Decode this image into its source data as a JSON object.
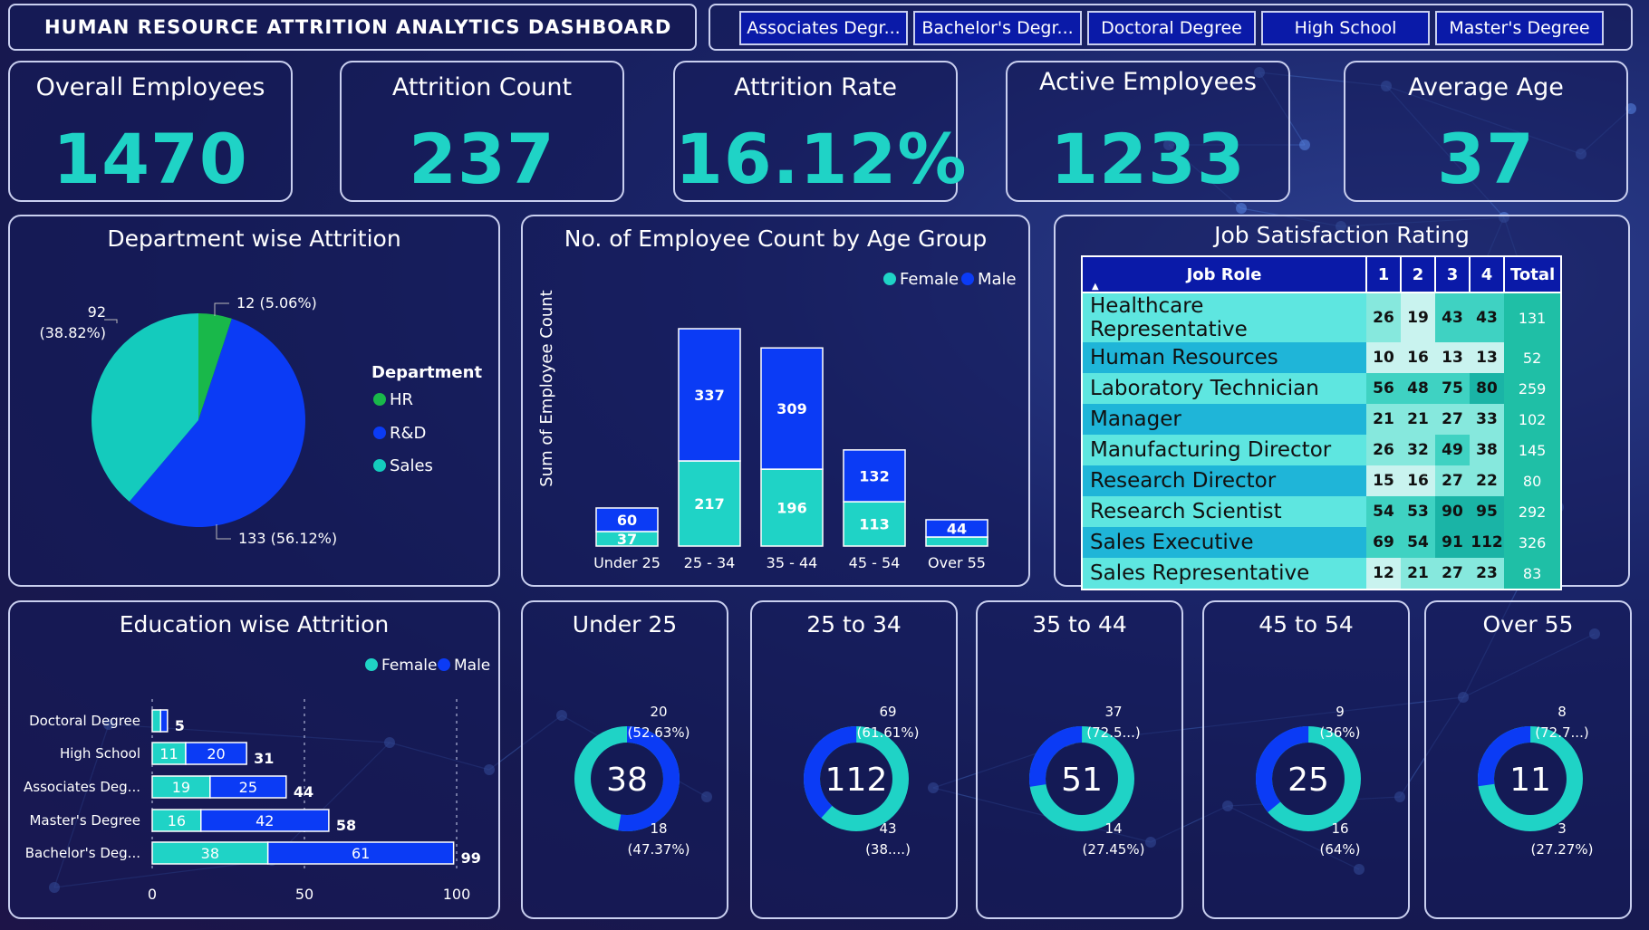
{
  "title": "HUMAN RESOURCE ATTRITION ANALYTICS DASHBOARD",
  "slicer": [
    "Associates Degr...",
    "Bachelor's Degr...",
    "Doctoral Degree",
    "High School",
    "Master's Degree"
  ],
  "kpis": [
    {
      "label": "Overall Employees",
      "value": "1470"
    },
    {
      "label": "Attrition Count",
      "value": "237"
    },
    {
      "label": "Attrition Rate",
      "value": "16.12%"
    },
    {
      "label": "Active Employees",
      "value": "1233"
    },
    {
      "label": "Average Age",
      "value": "37"
    }
  ],
  "colors": {
    "female": "#1fd3c6",
    "male": "#0b3bf5",
    "hr": "#19b84a",
    "rd": "#0b3bf5",
    "sales": "#14cbbd"
  },
  "dept": {
    "title": "Department wise Attrition",
    "legend_title": "Department",
    "slices": [
      {
        "name": "HR",
        "value": 12,
        "pct": "5.06%",
        "label": "12 (5.06%)"
      },
      {
        "name": "R&D",
        "value": 133,
        "pct": "56.12%",
        "label": "133 (56.12%)"
      },
      {
        "name": "Sales",
        "value": 92,
        "pct": "38.82%",
        "label_line1": "92",
        "label_line2": "(38.82%)"
      }
    ]
  },
  "age": {
    "title": "No. of Employee Count by Age Group",
    "ylabel": "Sum of Employee Count",
    "legend": [
      "Female",
      "Male"
    ]
  },
  "jobsat": {
    "title": "Job Satisfaction Rating",
    "headers": [
      "Job Role",
      "1",
      "2",
      "3",
      "4",
      "Total"
    ],
    "rows": [
      {
        "role": "Healthcare Representative",
        "v": [
          "26",
          "19",
          "43",
          "43"
        ],
        "total": "131"
      },
      {
        "role": "Human Resources",
        "v": [
          "10",
          "16",
          "13",
          "13"
        ],
        "total": "52"
      },
      {
        "role": "Laboratory Technician",
        "v": [
          "56",
          "48",
          "75",
          "80"
        ],
        "total": "259"
      },
      {
        "role": "Manager",
        "v": [
          "21",
          "21",
          "27",
          "33"
        ],
        "total": "102"
      },
      {
        "role": "Manufacturing Director",
        "v": [
          "26",
          "32",
          "49",
          "38"
        ],
        "total": "145"
      },
      {
        "role": "Research Director",
        "v": [
          "15",
          "16",
          "27",
          "22"
        ],
        "total": "80"
      },
      {
        "role": "Research Scientist",
        "v": [
          "54",
          "53",
          "90",
          "95"
        ],
        "total": "292"
      },
      {
        "role": "Sales Executive",
        "v": [
          "69",
          "54",
          "91",
          "112"
        ],
        "total": "326"
      },
      {
        "role": "Sales Representative",
        "v": [
          "12",
          "21",
          "27",
          "23"
        ],
        "total": "83"
      }
    ]
  },
  "edu": {
    "title": "Education wise Attrition",
    "legend": [
      "Female",
      "Male"
    ]
  },
  "donuts": [
    {
      "title": "Under 25",
      "total": "38",
      "female": 18,
      "male": 20,
      "lblA1": "20",
      "lblA2": "(52.63%)",
      "lblB1": "18",
      "lblB2": "(47.37%)"
    },
    {
      "title": "25 to 34",
      "total": "112",
      "female": 69,
      "male": 43,
      "lblA1": "69",
      "lblA2": "(61.61%)",
      "lblB1": "43",
      "lblB2": "(38....)"
    },
    {
      "title": "35 to 44",
      "total": "51",
      "female": 37,
      "male": 14,
      "lblA1": "37",
      "lblA2": "(72.5...)",
      "lblB1": "14",
      "lblB2": "(27.45%)"
    },
    {
      "title": "45 to 54",
      "total": "25",
      "female": 16,
      "male": 9,
      "lblA1": "9",
      "lblA2": "(36%)",
      "lblB1": "16",
      "lblB2": "(64%)"
    },
    {
      "title": "Over 55",
      "total": "11",
      "female": 8,
      "male": 3,
      "lblA1": "8",
      "lblA2": "(72.7...)",
      "lblB1": "3",
      "lblB2": "(27.27%)"
    }
  ],
  "chart_data": [
    {
      "type": "pie",
      "title": "Department wise Attrition",
      "categories": [
        "HR",
        "R&D",
        "Sales"
      ],
      "values": [
        12,
        133,
        92
      ]
    },
    {
      "type": "bar",
      "title": "No. of Employee Count by Age Group",
      "ylabel": "Sum of Employee Count",
      "stacked": true,
      "categories": [
        "Under 25",
        "25 - 34",
        "35 - 44",
        "45 - 54",
        "Over 55"
      ],
      "series": [
        {
          "name": "Female",
          "values": [
            37,
            217,
            196,
            113,
            null
          ]
        },
        {
          "name": "Male",
          "values": [
            60,
            337,
            309,
            132,
            44
          ]
        }
      ],
      "legend": "top-right"
    },
    {
      "type": "bar",
      "orientation": "horizontal",
      "stacked": true,
      "title": "Education wise Attrition",
      "categories": [
        "Doctoral Degree",
        "High School",
        "Associates Deg...",
        "Master's Degree",
        "Bachelor's Deg..."
      ],
      "series": [
        {
          "name": "Female",
          "values": [
            null,
            11,
            19,
            16,
            38
          ]
        },
        {
          "name": "Male",
          "values": [
            null,
            20,
            25,
            42,
            61
          ]
        }
      ],
      "totals": [
        5,
        31,
        44,
        58,
        99
      ],
      "xticks": [
        "0",
        "50",
        "100"
      ],
      "xlim": [
        0,
        100
      ],
      "legend": "top-right"
    },
    {
      "type": "table",
      "title": "Job Satisfaction Rating",
      "columns": [
        "Job Role",
        "1",
        "2",
        "3",
        "4",
        "Total"
      ]
    }
  ]
}
